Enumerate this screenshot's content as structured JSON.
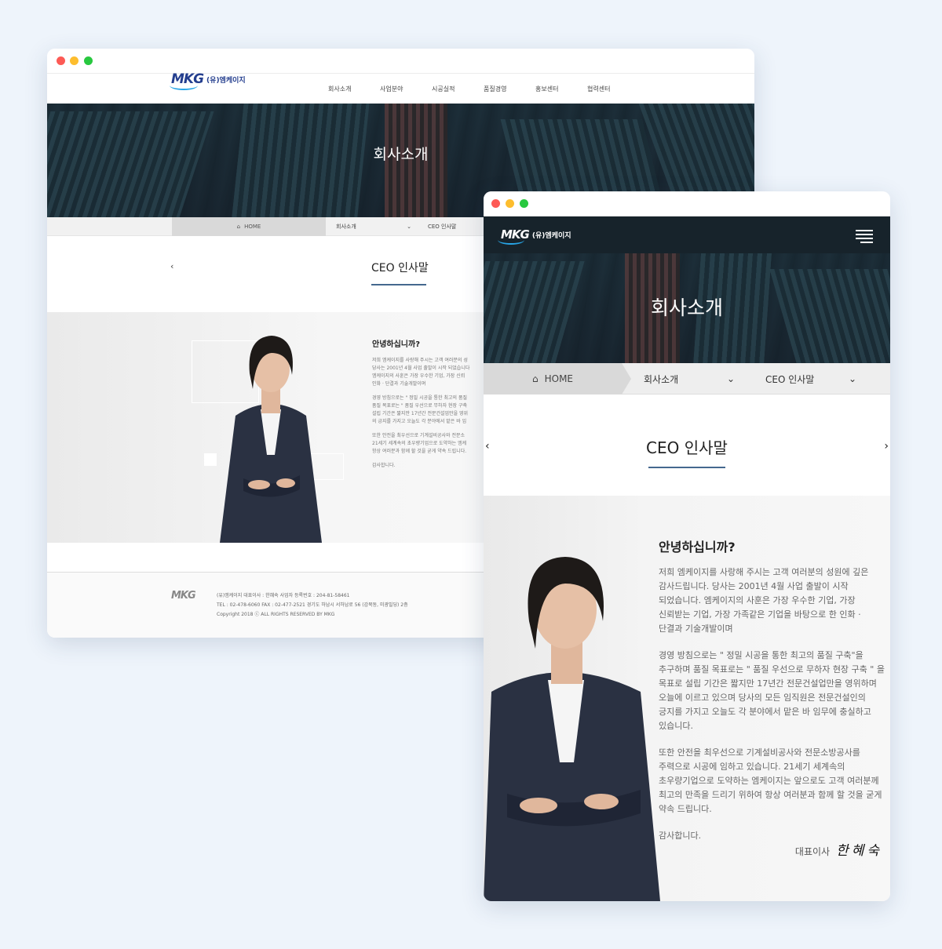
{
  "brand": {
    "mark": "MKG",
    "name": "(유)엠케이지"
  },
  "nav": [
    "회사소개",
    "사업분야",
    "시공실적",
    "품질경영",
    "홍보센터",
    "협력센터"
  ],
  "hero_title": "회사소개",
  "breadcrumb": {
    "desktop": {
      "home": "HOME",
      "section": "회사소개",
      "page": "CEO 인사말"
    },
    "mobile": {
      "home": "HOME",
      "section": "회사소개",
      "page": "CEO 인사말"
    }
  },
  "page_title": "CEO 인사말",
  "desktop_greeting": {
    "heading": "안녕하십니까?",
    "lines": [
      "저희 엠케이지를 사랑해 주시는 고객 여러분의 성",
      "당사는 2001년 4월 사업 출발이 시작 되었습니다",
      "엠케이지의 사훈은 가장 우수한 기업, 가장 신뢰",
      "인화 · 단결과 기술개발이며",
      "경영 방침으로는 \" 정밀 시공을 통한 최고의 품질",
      "품질 목표로는 \" 품질 우선으로 무하자 현장 구축",
      "설립 기간은 짧지만 17년간 전문건설업만을 영위",
      "의 긍지를 가지고 오늘도 각 분야에서 맡은 바 임",
      "또한 안전을 최우선으로 기계설비공사와 전문소",
      "21세기 세계속의 초우량기업으로 도약하는 엠케",
      "항상 여러분과 함께 할 것을 굳게 약속 드립니다.",
      "감사합니다."
    ]
  },
  "mobile_greeting": {
    "heading": "안녕하십니까?",
    "paragraphs": [
      "저희 엠케이지를 사랑해 주시는 고객 여러분의 성원에 깊은 감사드립니다. 당사는 2001년 4월 사업 출발이 시작 되었습니다. 엠케이지의 사훈은 가장 우수한 기업, 가장 신뢰받는 기업, 가장 가족같은 기업을 바탕으로 한 인화 · 단결과 기술개발이며",
      "경영 방침으로는 \" 정밀 시공을 통한 최고의 품질 구축\"을 추구하며 품질 목표로는 \" 품질 우선으로 무하자 현장 구축 \" 을 목표로 설립 기간은 짧지만 17년간 전문건설업만을 영위하며 오늘에 이르고 있으며 당사의 모든 임직원은 전문건설인의 긍지를 가지고 오늘도 각 분야에서 맡은 바 임무에 충실하고 있습니다.",
      "또한 안전을 최우선으로 기계설비공사와 전문소방공사를 주력으로 시공에 임하고 있습니다. 21세기 세계속의 초우량기업으로 도약하는 엠케이지는 앞으로도 고객 여러분께 최고의 만족을 드리기 위하여 항상 여러분과 함께 할 것을 굳게 약속 드립니다.",
      "감사합니다."
    ],
    "signature_role": "대표이사",
    "signature_name": "한혜숙"
  },
  "footer": {
    "line1": "(유)엠케이지     대표이사 : 한혜숙     사업자 등록번호 : 204-81-58461",
    "line2": "TEL : 02-478-6060     FAX : 02-477-2521     경기도 하남시 서하남로 56 (감북동, 미광빌딩) 2층",
    "line3": "Copyright 2018 ⓒ ALL RIGHTS RESERVED BY MKG"
  },
  "icons": {
    "home": "home-icon",
    "menu": "hamburger-icon",
    "prev": "chevron-left-icon",
    "next": "chevron-right-icon",
    "dropdown": "chevron-down-icon"
  },
  "colors": {
    "page_bg": "#eef4fb",
    "brand_blue": "#243e8e",
    "accent_line": "#44688e",
    "header_dark": "#17232b"
  }
}
